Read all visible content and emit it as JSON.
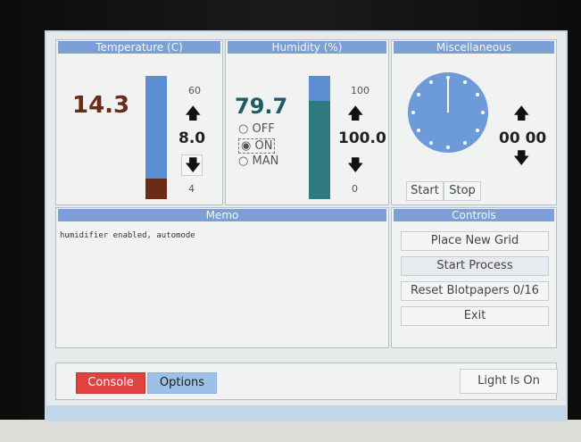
{
  "panels": {
    "temperature": {
      "title": "Temperature (C)",
      "current_value": "14.3",
      "max_label": "60",
      "setpoint": "8.0",
      "min_label": "4",
      "level_fraction": 0.17
    },
    "humidity": {
      "title": "Humidity (%)",
      "current_value": "79.7",
      "max_label": "100",
      "setpoint": "100.0",
      "min_label": "0",
      "level_fraction": 0.8,
      "mode_options": [
        "OFF",
        "ON",
        "MAN"
      ],
      "selected_mode": "ON"
    },
    "misc": {
      "title": "Miscellaneous",
      "timer_value": "00 00",
      "start_label": "Start",
      "stop_label": "Stop"
    },
    "memo": {
      "title": "Memo",
      "text": "humidifier enabled, automode"
    },
    "controls": {
      "title": "Controls",
      "buttons": [
        "Place New Grid",
        "Start Process",
        "Reset Blotpapers 0/16",
        "Exit"
      ]
    }
  },
  "footer": {
    "console_label": "Console",
    "options_label": "Options",
    "light_label": "Light Is On"
  },
  "colors": {
    "title_bar": "#7c9fd5",
    "temp_value": "#6b2b1a",
    "humidity_value": "#1f5b66",
    "bar_blue": "#5b8fd2",
    "bar_temp_fill": "#6a2b17",
    "bar_humidity_fill": "#2f7a7f",
    "console_red": "#e0423f",
    "options_blue": "#9fc0e6"
  },
  "icons": {
    "up": "up-arrow-icon",
    "down": "down-arrow-icon",
    "clock": "clock-icon"
  }
}
